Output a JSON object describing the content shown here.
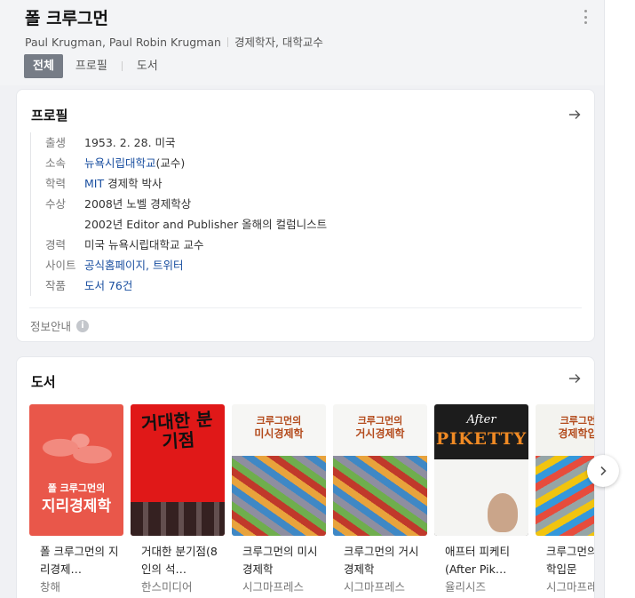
{
  "header": {
    "title": "폴 크루그먼",
    "names": "Paul Krugman, Paul Robin Krugman",
    "occupation": "경제학자, 대학교수"
  },
  "tabs": [
    {
      "label": "전체",
      "active": true
    },
    {
      "label": "프로필",
      "active": false
    },
    {
      "label": "도서",
      "active": false
    }
  ],
  "profile": {
    "title": "프로필",
    "rows": [
      {
        "key": "출생",
        "values": [
          "1953. 2. 28. 미국"
        ]
      },
      {
        "key": "소속",
        "link": "뉴욕시립대학교",
        "suffix": "(교수)"
      },
      {
        "key": "학력",
        "link": "MIT",
        "suffix": " 경제학 박사"
      },
      {
        "key": "수상",
        "values": [
          "2008년 노벨 경제학상",
          "2002년 Editor and Publisher 올해의 컬럼니스트"
        ]
      },
      {
        "key": "경력",
        "values": [
          "미국 뉴욕시립대학교 교수"
        ]
      },
      {
        "key": "사이트",
        "links": "공식홈페이지, 트위터"
      },
      {
        "key": "작품",
        "links": "도서 76건"
      }
    ],
    "info_label": "정보안내",
    "info_icon": "i"
  },
  "books": {
    "title": "도서",
    "items": [
      {
        "title": "폴 크루그먼의 지리경제…",
        "publisher": "창해",
        "cover": {
          "line1": "폴 크루그먼의",
          "line2": "지리경제학"
        }
      },
      {
        "title": "거대한 분기점(8인의 석…",
        "publisher": "한스미디어",
        "cover": {
          "line1": "거대한 분기점"
        }
      },
      {
        "title": "크루그먼의 미시경제학",
        "publisher": "시그마프레스",
        "cover": {
          "line1": "크루그먼의",
          "line2": "미시경제학"
        }
      },
      {
        "title": "크루그먼의 거시경제학",
        "publisher": "시그마프레스",
        "cover": {
          "line1": "크루그먼의",
          "line2": "거시경제학"
        }
      },
      {
        "title": "애프터 피케티(After Pik…",
        "publisher": "율리시즈",
        "cover": {
          "line1": "After",
          "line2": "PIKETTY"
        }
      },
      {
        "title": "크루그먼의 경제학입문",
        "publisher": "시그마프레스",
        "cover": {
          "line1": "크루그먼의",
          "line2": "경제학입문"
        }
      }
    ]
  },
  "colors": {
    "accent_link": "#1a4fa0",
    "active_tab": "#767c86"
  }
}
